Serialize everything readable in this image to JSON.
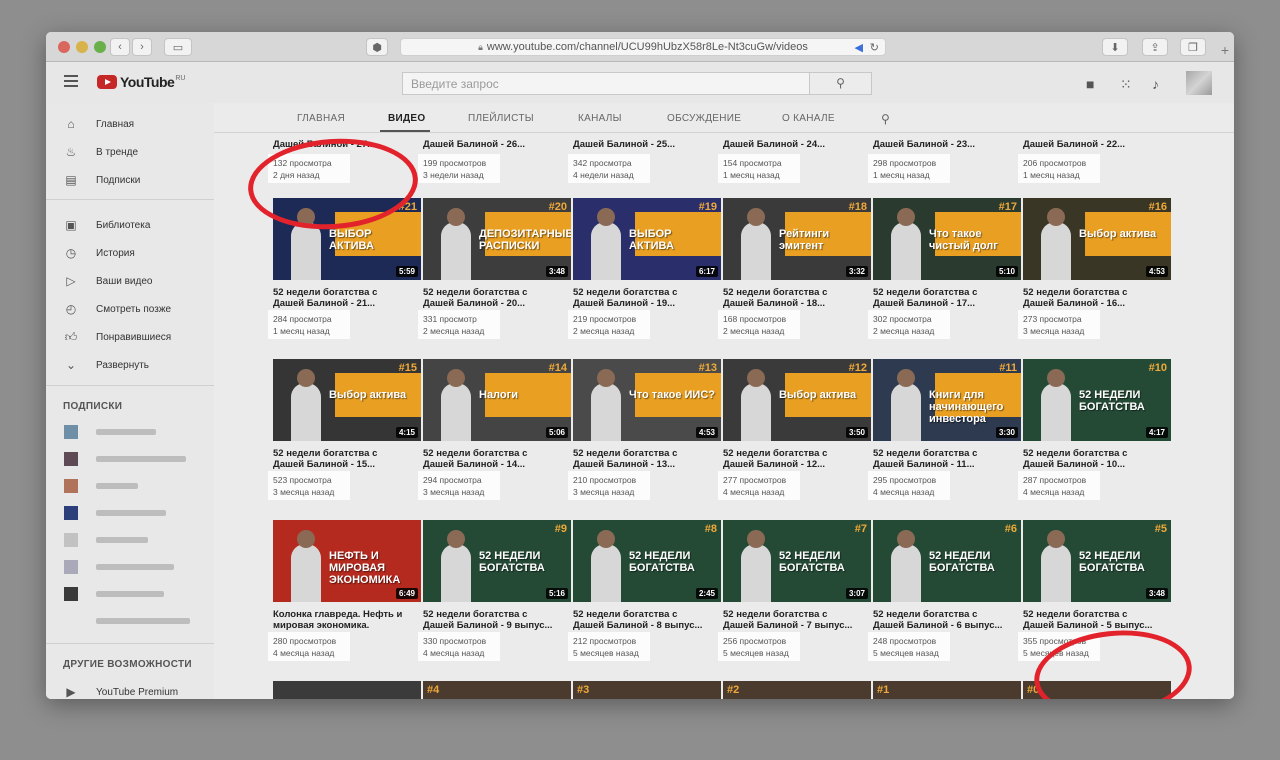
{
  "browser": {
    "url": "www.youtube.com/channel/UCU99hUbzX58r8Le-Nt3cuGw/videos",
    "new_tab": "+"
  },
  "header": {
    "logo_text": "YouTube",
    "logo_region": "RU",
    "search_placeholder": "Введите запрос"
  },
  "sidebar": {
    "items": [
      {
        "label": "Главная",
        "icon": "home-icon"
      },
      {
        "label": "В тренде",
        "icon": "trending-icon"
      },
      {
        "label": "Подписки",
        "icon": "subscriptions-icon"
      },
      {
        "label": "Библиотека",
        "icon": "library-icon"
      },
      {
        "label": "История",
        "icon": "history-icon"
      },
      {
        "label": "Ваши видео",
        "icon": "your-videos-icon"
      },
      {
        "label": "Смотреть позже",
        "icon": "watch-later-icon"
      },
      {
        "label": "Понравившиеся",
        "icon": "liked-icon"
      },
      {
        "label": "Развернуть",
        "icon": "chevron-down-icon"
      }
    ],
    "subscriptions_heading": "ПОДПИСКИ",
    "other_heading": "ДРУГИЕ ВОЗМОЖНОСТИ",
    "premium_label": "YouTube Premium"
  },
  "tabs": [
    "ГЛАВНАЯ",
    "ВИДЕО",
    "ПЛЕЙЛИСТЫ",
    "КАНАЛЫ",
    "ОБСУЖДЕНИЕ",
    "О КАНАЛЕ"
  ],
  "active_tab": "ВИДЕО",
  "top_partial_row": [
    {
      "title": "Дашей Балиной - 27...",
      "views": "132 просмотра",
      "age": "2 дня назад"
    },
    {
      "title": "Дашей Балиной - 26...",
      "views": "199 просмотров",
      "age": "3 недели назад"
    },
    {
      "title": "Дашей Балиной - 25...",
      "views": "342 просмотра",
      "age": "4 недели назад"
    },
    {
      "title": "Дашей Балиной - 24...",
      "views": "154 просмотра",
      "age": "1 месяц назад"
    },
    {
      "title": "Дашей Балиной - 23...",
      "views": "298 просмотров",
      "age": "1 месяц назад"
    },
    {
      "title": "Дашей Балиной - 22...",
      "views": "206 просмотров",
      "age": "1 месяц назад"
    }
  ],
  "rows": [
    [
      {
        "t1": "52 недели богатства с",
        "t2": "Дашей Балиной - 21...",
        "views": "284 просмотра",
        "age": "1 месяц назад",
        "dur": "5:59",
        "num": "#21",
        "big": "ВЫБОР АКТИВА",
        "bg": "#1d2a55"
      },
      {
        "t1": "52 недели богатства с",
        "t2": "Дашей Балиной - 20...",
        "views": "331 просмотр",
        "age": "2 месяца назад",
        "dur": "3:48",
        "num": "#20",
        "big": "ДЕПОЗИТАРНЫЕ РАСПИСКИ",
        "bg": "#3d3d3d"
      },
      {
        "t1": "52 недели богатства с",
        "t2": "Дашей Балиной - 19...",
        "views": "219 просмотров",
        "age": "2 месяца назад",
        "dur": "6:17",
        "num": "#19",
        "big": "ВЫБОР АКТИВА",
        "bg": "#2a2f6b"
      },
      {
        "t1": "52 недели богатства с",
        "t2": "Дашей Балиной - 18...",
        "views": "168 просмотров",
        "age": "2 месяца назад",
        "dur": "3:32",
        "num": "#18",
        "big": "Рейтинги эмитент",
        "bg": "#3a3a3a"
      },
      {
        "t1": "52 недели богатства с",
        "t2": "Дашей Балиной - 17...",
        "views": "302 просмотра",
        "age": "2 месяца назад",
        "dur": "5:10",
        "num": "#17",
        "big": "Что такое чистый долг",
        "bg": "#2b3a2e"
      },
      {
        "t1": "52 недели богатства с",
        "t2": "Дашей Балиной - 16...",
        "views": "273 просмотра",
        "age": "3 месяца назад",
        "dur": "4:53",
        "num": "#16",
        "big": "Выбор актива",
        "bg": "#3a3626"
      }
    ],
    [
      {
        "t1": "52 недели богатства с",
        "t2": "Дашей Балиной - 15...",
        "views": "523 просмотра",
        "age": "3 месяца назад",
        "dur": "4:15",
        "num": "#15",
        "big": "Выбор актива",
        "bg": "#353535"
      },
      {
        "t1": "52 недели богатства с",
        "t2": "Дашей Балиной - 14...",
        "views": "294 просмотра",
        "age": "3 месяца назад",
        "dur": "5:06",
        "num": "#14",
        "big": "Налоги",
        "bg": "#444"
      },
      {
        "t1": "52 недели богатства с",
        "t2": "Дашей Балиной - 13...",
        "views": "210 просмотров",
        "age": "3 месяца назад",
        "dur": "4:53",
        "num": "#13",
        "big": "Что такое ИИС?",
        "bg": "#4a4a4a"
      },
      {
        "t1": "52 недели богатства с",
        "t2": "Дашей Балиной - 12...",
        "views": "277 просмотров",
        "age": "4 месяца назад",
        "dur": "3:50",
        "num": "#12",
        "big": "Выбор актива",
        "bg": "#3a3a3a"
      },
      {
        "t1": "52 недели богатства с",
        "t2": "Дашей Балиной - 11...",
        "views": "295 просмотров",
        "age": "4 месяца назад",
        "dur": "3:30",
        "num": "#11",
        "big": "Книги для начинающего инвестора",
        "bg": "#2e3a4f"
      },
      {
        "t1": "52 недели богатства с",
        "t2": "Дашей Балиной - 10...",
        "views": "287 просмотров",
        "age": "4 месяца назад",
        "dur": "4:17",
        "num": "#10",
        "big": "52 НЕДЕЛИ БОГАТСТВА",
        "bg": "#244a36"
      }
    ],
    [
      {
        "t1": "Колонка главреда. Нефть и",
        "t2": "мировая экономика.",
        "views": "280 просмотров",
        "age": "4 месяца назад",
        "dur": "6:49",
        "num": "",
        "big": "НЕФТЬ И МИРОВАЯ ЭКОНОМИКА",
        "bg": "#b52a1e"
      },
      {
        "t1": "52 недели богатства с",
        "t2": "Дашей Балиной - 9 выпус...",
        "views": "330 просмотров",
        "age": "4 месяца назад",
        "dur": "5:16",
        "num": "#9",
        "big": "52 НЕДЕЛИ БОГАТСТВА",
        "bg": "#244a36"
      },
      {
        "t1": "52 недели богатства с",
        "t2": "Дашей Балиной - 8 выпус...",
        "views": "212 просмотров",
        "age": "5 месяцев назад",
        "dur": "2:45",
        "num": "#8",
        "big": "52 НЕДЕЛИ БОГАТСТВА",
        "bg": "#244a36"
      },
      {
        "t1": "52 недели богатства с",
        "t2": "Дашей Балиной - 7 выпус...",
        "views": "256 просмотров",
        "age": "5 месяцев назад",
        "dur": "3:07",
        "num": "#7",
        "big": "52 НЕДЕЛИ БОГАТСТВА",
        "bg": "#244a36"
      },
      {
        "t1": "52 недели богатства с",
        "t2": "Дашей Балиной - 6 выпус...",
        "views": "248 просмотров",
        "age": "5 месяцев назад",
        "dur": "",
        "num": "#6",
        "big": "52 НЕДЕЛИ БОГАТСТВА",
        "bg": "#244a36"
      },
      {
        "t1": "52 недели богатства с",
        "t2": "Дашей Балиной - 5 выпус...",
        "views": "355 просмотров",
        "age": "5 месяцев назад",
        "dur": "3:48",
        "num": "#5",
        "big": "52 НЕДЕЛИ БОГАТСТВА",
        "bg": "#244a36"
      }
    ]
  ],
  "bottom_partial_nums": [
    "",
    "#4",
    "#3",
    "#2",
    "#1",
    "#0"
  ],
  "colors": {
    "annotation": "#e3232b",
    "accent_orange": "#e89f22",
    "youtube_red": "#c62828"
  }
}
